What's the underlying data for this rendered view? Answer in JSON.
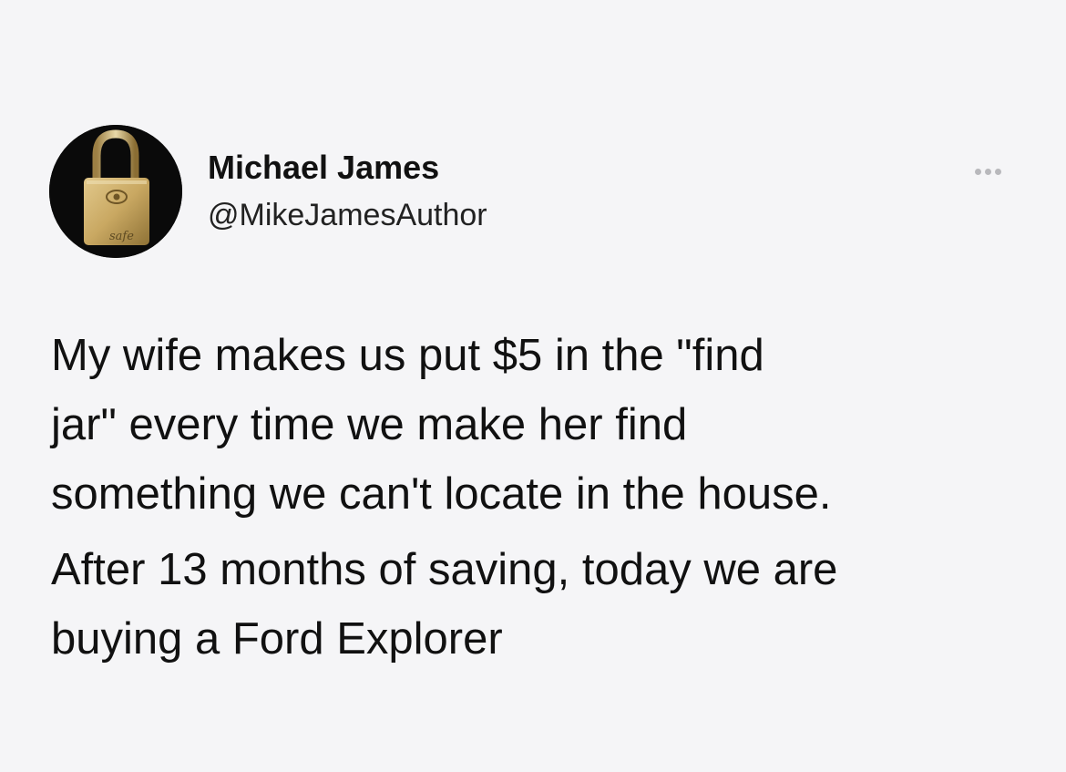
{
  "tweet": {
    "author": {
      "display_name": "Michael James",
      "handle": "@MikeJamesAuthor",
      "avatar_icon": "padlock-icon",
      "avatar_engraving": "safe"
    },
    "more_icon": "more-options-icon",
    "paragraphs": [
      "My wife makes us put $5 in the \"find\njar\" every time we make her find\nsomething we can't locate in the house.",
      "After 13 months of saving, today we are\nbuying a Ford Explorer"
    ]
  },
  "colors": {
    "background": "#f5f5f7",
    "text": "#111111",
    "avatar_background": "#0a0a0a",
    "padlock_gold": "#c9a862",
    "more_dots": "#b8b8bc"
  }
}
